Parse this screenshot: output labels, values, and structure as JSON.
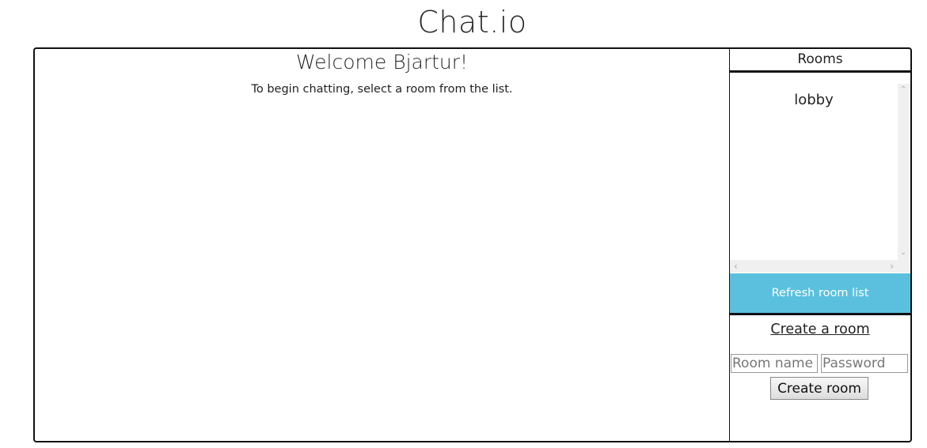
{
  "app": {
    "title": "Chat.io"
  },
  "main": {
    "welcome_heading": "Welcome Bjartur!",
    "hint": "To begin chatting, select a room from the list."
  },
  "sidebar": {
    "rooms_header": "Rooms",
    "rooms": [
      {
        "name": "lobby"
      }
    ],
    "refresh_label": "Refresh room list",
    "create_heading": "Create a room",
    "room_name_placeholder": "Room name",
    "password_placeholder": "Password",
    "create_button_label": "Create room"
  },
  "colors": {
    "accent": "#5bc0de",
    "border": "#111111"
  },
  "icons": {
    "scroll_up": "chevron-up-icon",
    "scroll_down": "chevron-down-icon",
    "scroll_left": "chevron-left-icon",
    "scroll_right": "chevron-right-icon"
  }
}
